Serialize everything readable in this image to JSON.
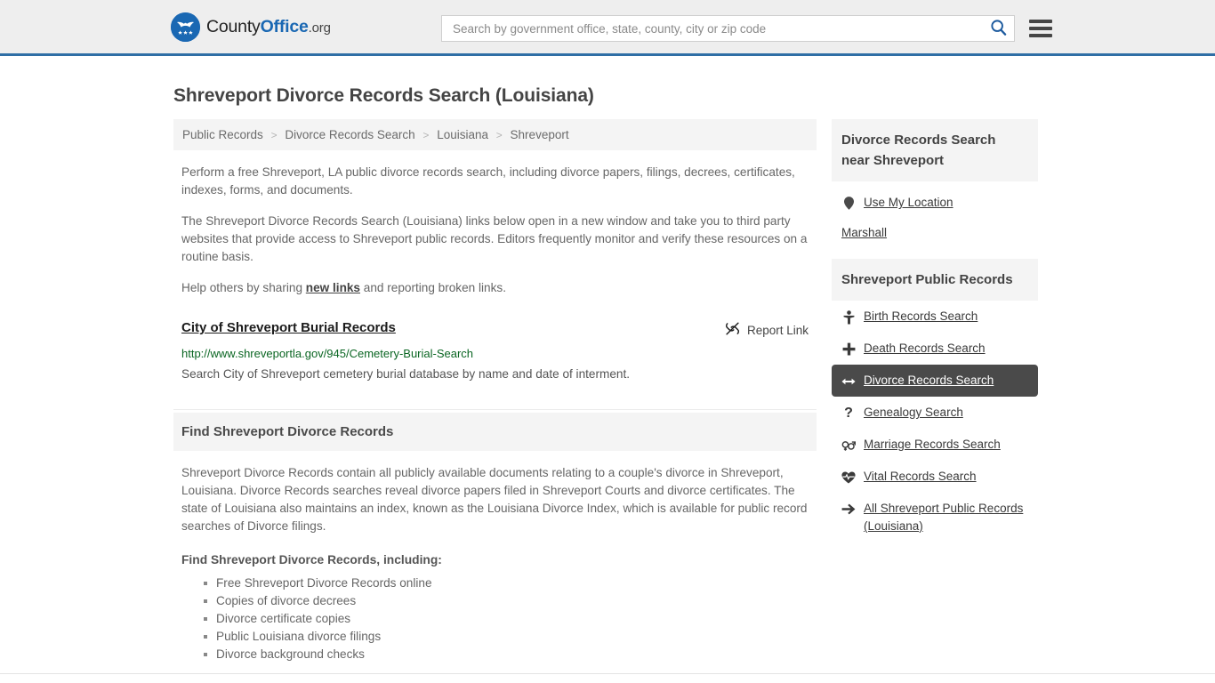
{
  "header": {
    "logo": {
      "part1": "County",
      "part2": "Office",
      "part3": ".org",
      "icon": "eagle-shield-logo"
    },
    "search": {
      "placeholder": "Search by government office, state, county, city or zip code",
      "value": "",
      "button_icon": "search-icon"
    },
    "menu_icon": "hamburger-menu-icon",
    "accent_color": "#2f6ea5"
  },
  "page": {
    "title": "Shreveport Divorce Records Search (Louisiana)"
  },
  "breadcrumb": {
    "items": [
      {
        "label": "Public Records"
      },
      {
        "label": "Divorce Records Search"
      },
      {
        "label": "Louisiana"
      },
      {
        "label": "Shreveport"
      }
    ],
    "separator": ">"
  },
  "intro": {
    "paragraph1": "Perform a free Shreveport, LA public divorce records search, including divorce papers, filings, decrees, certificates, indexes, forms, and documents.",
    "paragraph2": "The Shreveport Divorce Records Search (Louisiana) links below open in a new window and take you to third party websites that provide access to Shreveport public records. Editors frequently monitor and verify these resources on a routine basis.",
    "paragraph3_before": "Help others by sharing ",
    "paragraph3_link": "new links",
    "paragraph3_after": " and reporting broken links."
  },
  "result": {
    "title": "City of Shreveport Burial Records",
    "url": "http://www.shreveportla.gov/945/Cemetery-Burial-Search",
    "description": "Search City of Shreveport cemetery burial database by name and date of interment.",
    "report_label": "Report Link",
    "report_icon": "broken-link-icon",
    "url_color": "#0b6623"
  },
  "find_section": {
    "heading": "Find Shreveport Divorce Records",
    "body": "Shreveport Divorce Records contain all publicly available documents relating to a couple's divorce in Shreveport, Louisiana. Divorce Records searches reveal divorce papers filed in Shreveport Courts and divorce certificates. The state of Louisiana also maintains an index, known as the Louisiana Divorce Index, which is available for public record searches of Divorce filings.",
    "list_heading": "Find Shreveport Divorce Records, including:",
    "bullets": [
      "Free Shreveport Divorce Records online",
      "Copies of divorce decrees",
      "Divorce certificate copies",
      "Public Louisiana divorce filings",
      "Divorce background checks"
    ]
  },
  "sidebar": {
    "nearby": {
      "heading": "Divorce Records Search near Shreveport",
      "use_my_location": "Use My Location",
      "location_icon": "map-pin-icon",
      "places": [
        {
          "label": "Marshall"
        }
      ]
    },
    "public_records": {
      "heading": "Shreveport Public Records",
      "items": [
        {
          "label": "Birth Records Search",
          "icon": "child-icon",
          "active": false
        },
        {
          "label": "Death Records Search",
          "icon": "plus-cross-icon",
          "active": false
        },
        {
          "label": "Divorce Records Search",
          "icon": "arrows-left-right-icon",
          "active": true
        },
        {
          "label": "Genealogy Search",
          "icon": "question-mark-icon",
          "active": false
        },
        {
          "label": "Marriage Records Search",
          "icon": "venus-mars-icon",
          "active": false
        },
        {
          "label": "Vital Records Search",
          "icon": "heartbeat-icon",
          "active": false
        },
        {
          "label": "All Shreveport Public Records (Louisiana)",
          "icon": "arrow-right-icon",
          "active": false
        }
      ],
      "active_background": "#4a4a4a"
    }
  }
}
